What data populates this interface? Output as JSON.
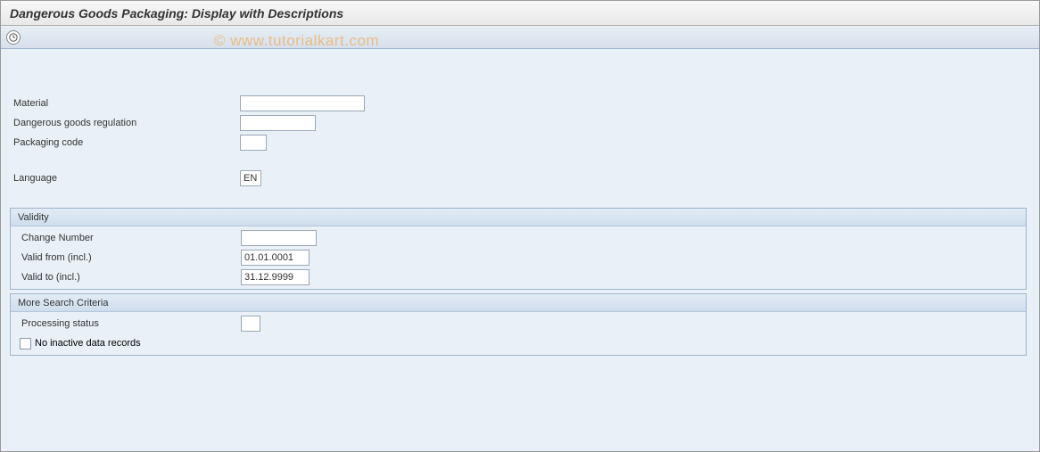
{
  "header": {
    "title": "Dangerous Goods Packaging: Display with Descriptions"
  },
  "watermark": "© www.tutorialkart.com",
  "fields": {
    "material_label": "Material",
    "material_value": "",
    "dg_regulation_label": "Dangerous goods regulation",
    "dg_regulation_value": "",
    "packaging_code_label": "Packaging code",
    "packaging_code_value": "",
    "language_label": "Language",
    "language_value": "EN"
  },
  "validity": {
    "title": "Validity",
    "change_number_label": "Change Number",
    "change_number_value": "",
    "valid_from_label": "Valid from (incl.)",
    "valid_from_value": "01.01.0001",
    "valid_to_label": "Valid to (incl.)",
    "valid_to_value": "31.12.9999"
  },
  "more_criteria": {
    "title": "More Search Criteria",
    "processing_status_label": "Processing status",
    "processing_status_value": "",
    "no_inactive_label": "No inactive data records",
    "no_inactive_checked": false
  }
}
